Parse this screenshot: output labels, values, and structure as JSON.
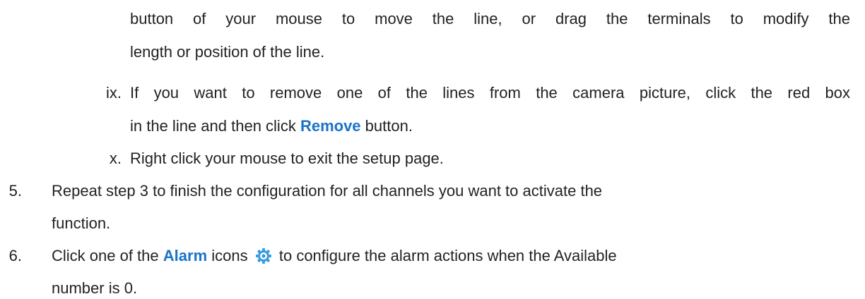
{
  "item_viii": {
    "line1": "button of your mouse to move the line, or drag the terminals to modify the",
    "line2": "length or position of the line."
  },
  "item_ix": {
    "number": "ix.",
    "line1": "If you want to remove one of the lines from the camera picture, click the red box",
    "line2_before": "in the line and then click",
    "keyword": "Remove",
    "line2_after": "button."
  },
  "item_x": {
    "number": "x.",
    "text": "Right click your mouse to exit the setup page."
  },
  "step_5": {
    "number": "5.",
    "line1": "Repeat step 3 to finish the configuration for all channels you want to activate the",
    "line2": "function."
  },
  "step_6": {
    "number": "6.",
    "line1_before": "Click one of the",
    "keyword": "Alarm",
    "line1_middle": "icons",
    "icon": "gear-icon",
    "line1_after": "to configure the alarm actions when the Available",
    "line2": "number is 0."
  },
  "colors": {
    "keyword": "#1a73c9",
    "text": "#222222",
    "icon": "#3a9be0"
  }
}
